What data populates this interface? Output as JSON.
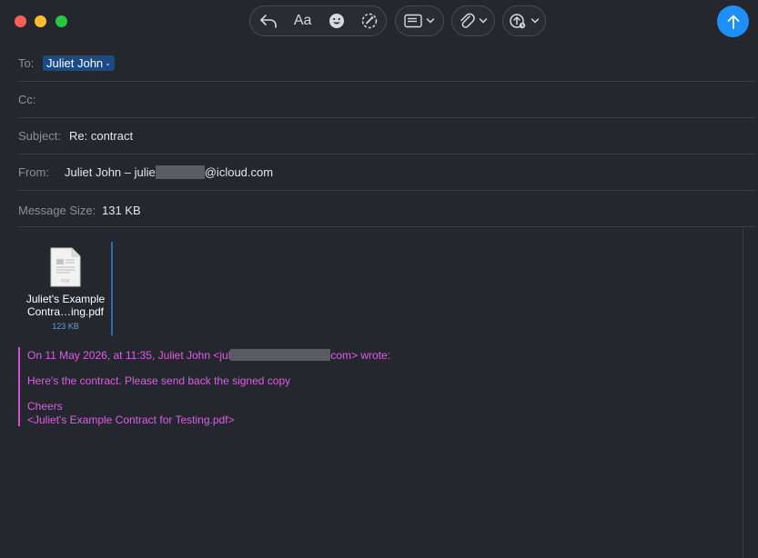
{
  "toolbar": {
    "font_label": "Aa",
    "icons": [
      "reply-icon",
      "emoji-icon",
      "markup-icon",
      "header-fields-icon",
      "attachment-icon",
      "photo-icon",
      "send-icon"
    ]
  },
  "header": {
    "to_label": "To:",
    "to_value": "Juliet John",
    "cc_label": "Cc:",
    "subject_label": "Subject:",
    "subject_value": "Re: contract",
    "from_label": "From:",
    "from_value_prefix": "Juliet John – julie",
    "from_value_suffix": "@icloud.com",
    "size_label": "Message Size:",
    "size_value": "131 KB"
  },
  "attachment": {
    "name_line1": "Juliet's Example",
    "name_line2": "Contra…ing.pdf",
    "size": "123 KB"
  },
  "quote": {
    "header_prefix": "On 11 May 2026, at 11:35, Juliet John <jul",
    "header_suffix": "com> wrote:",
    "message": "Here's the contract. Please send back the signed copy",
    "signoff": "Cheers",
    "attachment_ref": "<Juliet's Example Contract for Testing.pdf>"
  },
  "colors": {
    "accent": "#1e8ff6",
    "quote": "#e05ce6",
    "token": "#1b4b85"
  }
}
